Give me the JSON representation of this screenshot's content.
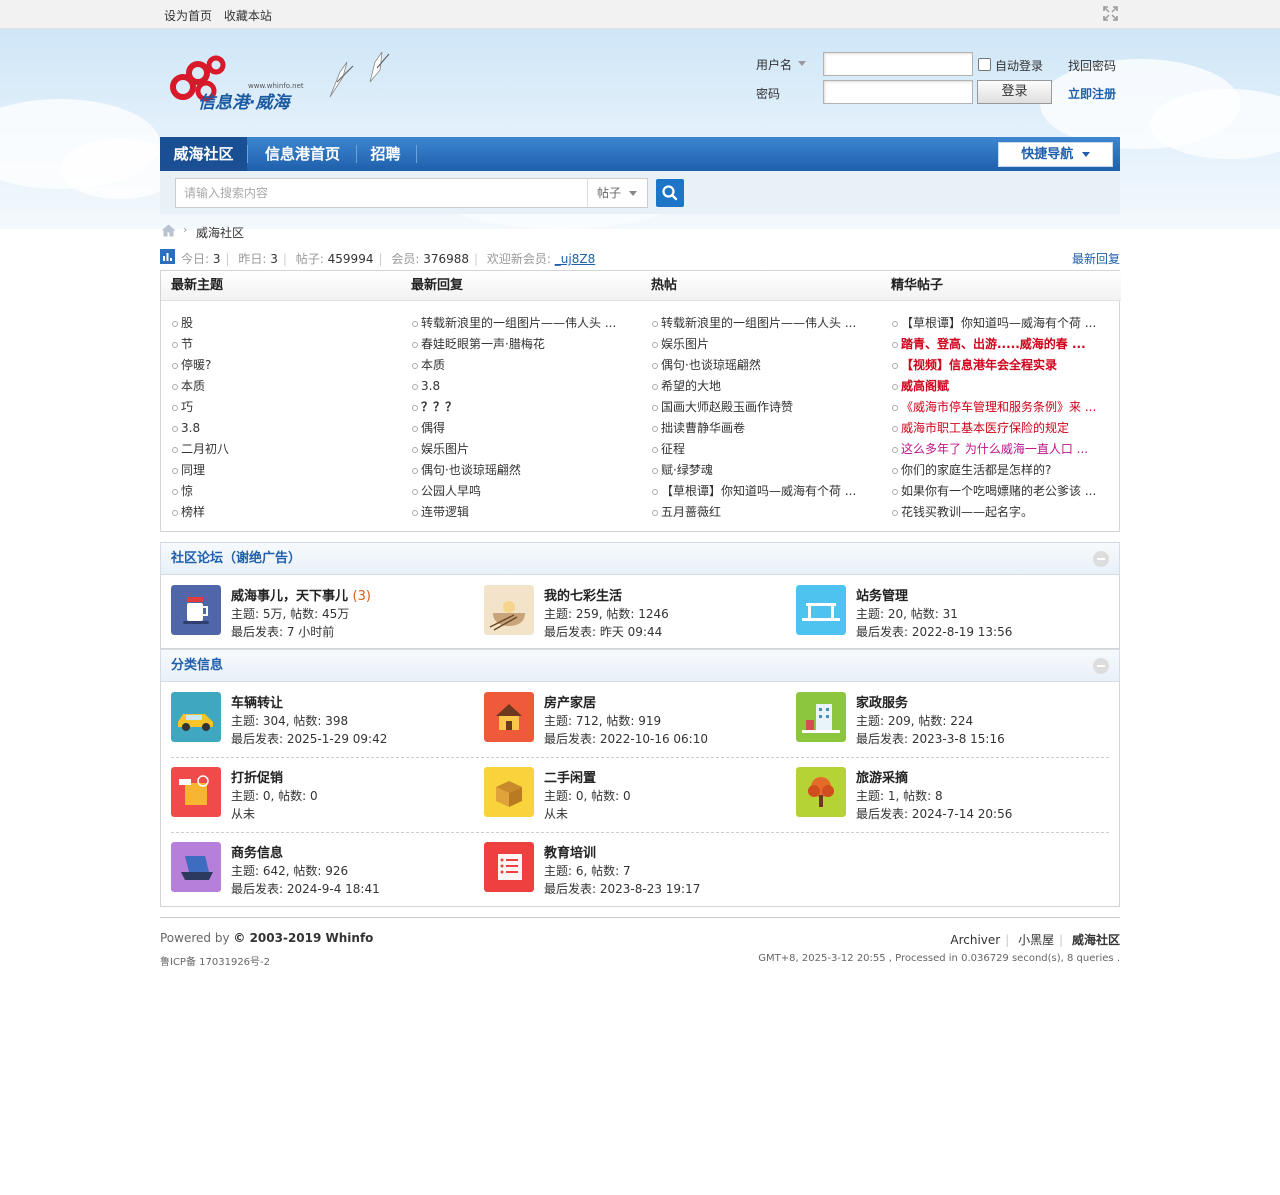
{
  "topbar": {
    "set_home": "设为首页",
    "bookmark": "收藏本站"
  },
  "header": {
    "logo_text": "信息港·威海",
    "logo_url": "www.whinfo.net"
  },
  "login": {
    "username_label": "用户名",
    "password_label": "密码",
    "auto_login": "自动登录",
    "recover": "找回密码",
    "login_button": "登录",
    "register": "立即注册"
  },
  "nav": {
    "items": [
      {
        "label": "威海社区",
        "active": true
      },
      {
        "label": "信息港首页",
        "active": false
      },
      {
        "label": "招聘",
        "active": false
      }
    ],
    "quick_nav": "快捷导航"
  },
  "search": {
    "placeholder": "请输入搜索内容",
    "type": "帖子"
  },
  "breadcrumb": {
    "current": "威海社区"
  },
  "stats": {
    "today_label": "今日:",
    "today": "3",
    "yesterday_label": "昨日:",
    "yesterday": "3",
    "posts_label": "帖子:",
    "posts": "459994",
    "members_label": "会员:",
    "members": "376988",
    "welcome_label": "欢迎新会员:",
    "newest": "_uj8Z8",
    "latest_reply": "最新回复"
  },
  "topics": {
    "columns": [
      {
        "title": "最新主题",
        "items": [
          {
            "text": "股"
          },
          {
            "text": "节"
          },
          {
            "text": "停暖?"
          },
          {
            "text": "本质"
          },
          {
            "text": "巧"
          },
          {
            "text": "3.8"
          },
          {
            "text": "二月初八"
          },
          {
            "text": "同理"
          },
          {
            "text": "惊"
          },
          {
            "text": "榜样"
          }
        ]
      },
      {
        "title": "最新回复",
        "items": [
          {
            "text": "转载新浪里的一组图片——伟人头 ..."
          },
          {
            "text": "春娃眨眼第一声·腊梅花"
          },
          {
            "text": "本质"
          },
          {
            "text": "3.8"
          },
          {
            "text": "？？？"
          },
          {
            "text": "偶得"
          },
          {
            "text": "娱乐图片"
          },
          {
            "text": "偶句·也谈琼瑶翩然"
          },
          {
            "text": "公园人早鸣"
          },
          {
            "text": "连带逻辑"
          }
        ]
      },
      {
        "title": "热帖",
        "items": [
          {
            "text": "转载新浪里的一组图片——伟人头 ..."
          },
          {
            "text": "娱乐图片"
          },
          {
            "text": "偶句·也谈琼瑶翩然"
          },
          {
            "text": "希望的大地"
          },
          {
            "text": "国画大师赵殿玉画作诗赞"
          },
          {
            "text": "拙读曹静华画卷"
          },
          {
            "text": "征程"
          },
          {
            "text": "赋·绿梦魂"
          },
          {
            "text": "【草根谭】你知道吗—威海有个荷 ..."
          },
          {
            "text": "五月蔷薇红"
          }
        ]
      },
      {
        "title": "精华帖子",
        "items": [
          {
            "text": "【草根谭】你知道吗—威海有个荷 ...",
            "style": ""
          },
          {
            "text": "踏青、登高、出游.....威海的春 ...",
            "style": "red"
          },
          {
            "text": "【视频】信息港年会全程实录",
            "style": "red"
          },
          {
            "text": "威高阁赋",
            "style": "red"
          },
          {
            "text": "《威海市停车管理和服务条例》来 ...",
            "style": "redn"
          },
          {
            "text": "威海市职工基本医疗保险的规定",
            "style": "redn"
          },
          {
            "text": "这么多年了 为什么威海一直人口 ...",
            "style": "redn"
          },
          {
            "text": "你们的家庭生活都是怎样的?",
            "style": ""
          },
          {
            "text": "如果你有一个吃喝嫖赌的老公爹该 ...",
            "style": ""
          },
          {
            "text": "花钱买教训——起名字。",
            "style": ""
          }
        ]
      }
    ]
  },
  "community": {
    "title": "社区论坛（谢绝广告）",
    "forums": [
      {
        "name": "威海事儿，天下事儿",
        "today": "(3)",
        "topics": "主题: 5万, 帖数: 45万",
        "last": "最后发表: 7 小时前",
        "icon": "cup-icon",
        "color": "#4f67a8"
      },
      {
        "name": "我的七彩生活",
        "today": "",
        "topics": "主题: 259, 帖数: 1246",
        "last": "最后发表: 昨天 09:44",
        "icon": "bowl-icon",
        "color": "#f3e4c9"
      },
      {
        "name": "站务管理",
        "today": "",
        "topics": "主题: 20, 帖数: 31",
        "last": "最后发表: 2022-8-19 13:56",
        "icon": "bridge-icon",
        "color": "#4fc3f0"
      }
    ]
  },
  "classified": {
    "title": "分类信息",
    "forums": [
      {
        "name": "车辆转让",
        "topics": "主题: 304, 帖数: 398",
        "last": "最后发表: 2025-1-29 09:42",
        "icon": "car-icon",
        "color": "#3fa7bf"
      },
      {
        "name": "房产家居",
        "topics": "主题: 712, 帖数: 919",
        "last": "最后发表: 2022-10-16 06:10",
        "icon": "house-icon",
        "color": "#ef5a3b"
      },
      {
        "name": "家政服务",
        "topics": "主题: 209, 帖数: 224",
        "last": "最后发表: 2023-3-8 15:16",
        "icon": "building-icon",
        "color": "#8cc63f"
      },
      {
        "name": "打折促销",
        "topics": "主题: 0, 帖数: 0",
        "last": "从未",
        "icon": "tag-icon",
        "color": "#f04a4a"
      },
      {
        "name": "二手闲置",
        "topics": "主题: 0, 帖数: 0",
        "last": "从未",
        "icon": "box-icon",
        "color": "#f9d33b"
      },
      {
        "name": "旅游采摘",
        "topics": "主题: 1, 帖数: 8",
        "last": "最后发表: 2024-7-14 20:56",
        "icon": "tree-icon",
        "color": "#b5d334"
      },
      {
        "name": "商务信息",
        "topics": "主题: 642, 帖数: 926",
        "last": "最后发表: 2024-9-4 18:41",
        "icon": "laptop-icon",
        "color": "#b67fd9"
      },
      {
        "name": "教育培训",
        "topics": "主题: 6, 帖数: 7",
        "last": "最后发表: 2023-8-23 19:17",
        "icon": "list-icon",
        "color": "#ef4040"
      }
    ]
  },
  "footer": {
    "powered": "Powered by",
    "copyright": "© 2003-2019 Whinfo",
    "icp": "鲁ICP备 17031926号-2",
    "links": [
      "Archiver",
      "小黑屋",
      "威海社区"
    ],
    "processed": "GMT+8, 2025-3-12 20:55 , Processed in 0.036729 second(s), 8 queries ."
  }
}
